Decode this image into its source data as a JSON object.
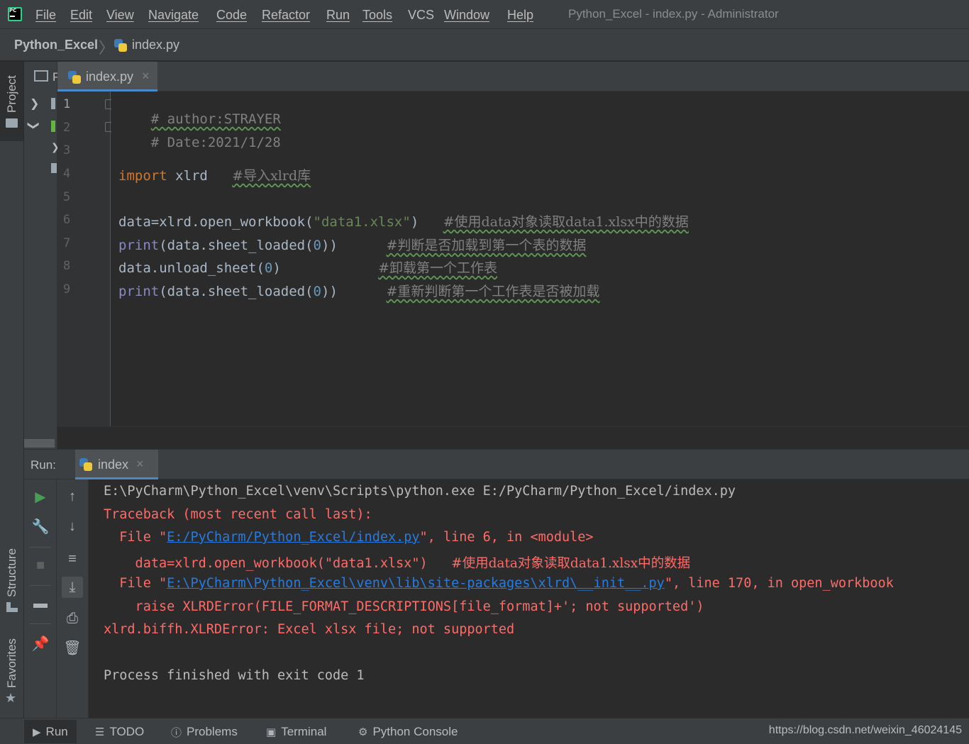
{
  "menubar": {
    "items": [
      "File",
      "Edit",
      "View",
      "Navigate",
      "Code",
      "Refactor",
      "Run",
      "Tools",
      "VCS",
      "Window",
      "Help"
    ],
    "window_title": "Python_Excel - index.py - Administrator"
  },
  "breadcrumb": {
    "project": "Python_Excel",
    "file": "index.py"
  },
  "side_stripe": {
    "project_label": "Project",
    "structure_label": "Structure",
    "favorites_label": "Favorites"
  },
  "project_pane": {
    "tab_label_partial": "P"
  },
  "editor": {
    "tab_label": "index.py",
    "line_numbers": [
      "1",
      "2",
      "3",
      "4",
      "5",
      "6",
      "7",
      "8",
      "9"
    ],
    "lines": {
      "l1_comment": "# author:STRAYER",
      "l2_comment": "# Date:2021/1/28",
      "l4_kw": "import",
      "l4_mod": " xlrd   ",
      "l4_comment": "#导入xlrd库",
      "l6_code_a": "data=xlrd.open_workbook(",
      "l6_str": "\"data1.xlsx\"",
      "l6_code_b": ")   ",
      "l6_comment": "#使用data对象读取data1.xlsx中的数据",
      "l7_fn": "print",
      "l7_code_a": "(data.sheet_loaded(",
      "l7_num": "0",
      "l7_code_b": "))      ",
      "l7_comment": "#判断是否加载到第一个表的数据",
      "l8_code_a": "data.unload_sheet(",
      "l8_num": "0",
      "l8_code_b": ")            ",
      "l8_comment": "#卸载第一个工作表",
      "l9_fn": "print",
      "l9_code_a": "(data.sheet_loaded(",
      "l9_num": "0",
      "l9_code_b": "))      ",
      "l9_comment": "#重新判断第一个工作表是否被加载"
    }
  },
  "run": {
    "title": "Run:",
    "tab_label": "index",
    "console": {
      "cmd": "E:\\PyCharm\\Python_Excel\\venv\\Scripts\\python.exe E:/PyCharm/Python_Excel/index.py",
      "traceback": "Traceback (most recent call last):",
      "f1_pre": "  File \"",
      "f1_link": "E:/PyCharm/Python_Excel/index.py",
      "f1_post": "\", line 6, in <module>",
      "src1_code": "    data=xlrd.open_workbook(\"data1.xlsx\")   ",
      "src1_comment": "#使用data对象读取data1.xlsx中的数据",
      "f2_pre": "  File \"",
      "f2_link": "E:\\PyCharm\\Python_Excel\\venv\\lib\\site-packages\\xlrd\\__init__.py",
      "f2_post": "\", line 170, in open_workbook",
      "src2": "    raise XLRDError(FILE_FORMAT_DESCRIPTIONS[file_format]+'; not supported')",
      "error": "xlrd.biffh.XLRDError: Excel xlsx file; not supported",
      "exit": "Process finished with exit code 1"
    }
  },
  "bottombar": {
    "run": "Run",
    "todo": "TODO",
    "problems": "Problems",
    "terminal": "Terminal",
    "python_console": "Python Console",
    "url": "https://blog.csdn.net/weixin_46024145"
  },
  "icons": {
    "accent": "#4a88c7",
    "run_green": "#499c54",
    "error_red": "#ff6b68",
    "link_blue": "#287bde"
  }
}
